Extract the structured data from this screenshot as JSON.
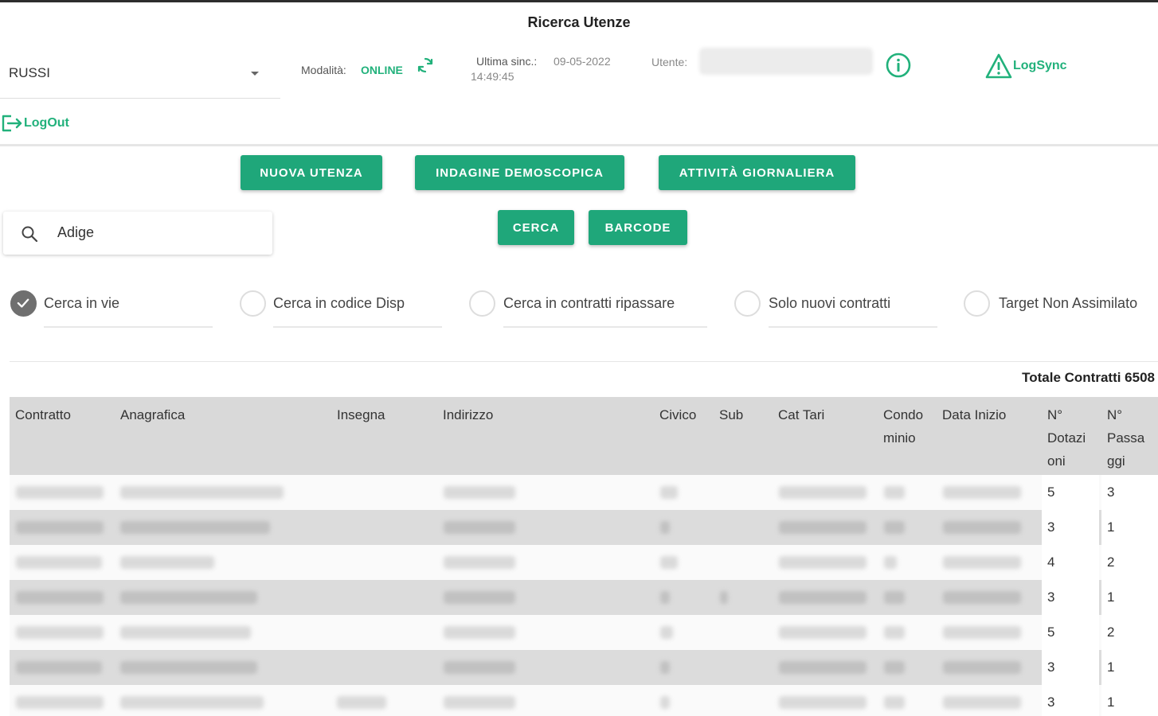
{
  "header": {
    "title": "Ricerca Utenze",
    "selector_value": "RUSSI",
    "mode_label": "Modalità:",
    "mode_value": "ONLINE",
    "sync_label": "Ultima sinc.:",
    "sync_date": "09-05-2022",
    "sync_time": "14:49:45",
    "user_label": "Utente:",
    "logsync_label": "LogSync",
    "logout_label": "LogOut"
  },
  "actions": {
    "new_user": "NUOVA UTENZA",
    "survey": "INDAGINE DEMOSCOPICA",
    "daily": "ATTIVITÀ GIORNALIERA",
    "search": "CERCA",
    "barcode": "BARCODE"
  },
  "search": {
    "value": "Adige"
  },
  "filters": [
    {
      "label": "Cerca in vie",
      "checked": true
    },
    {
      "label": "Cerca in codice Disp",
      "checked": false
    },
    {
      "label": "Cerca in contratti ripassare",
      "checked": false
    },
    {
      "label": "Solo nuovi contratti",
      "checked": false
    },
    {
      "label": "Target Non Assimilato",
      "checked": false
    }
  ],
  "table": {
    "total_label": "Totale Contratti 6508",
    "columns": [
      [
        "Contratto"
      ],
      [
        "Anagrafica"
      ],
      [
        "Insegna"
      ],
      [
        "Indirizzo"
      ],
      [
        "Civico"
      ],
      [
        "Sub"
      ],
      [
        "Cat Tari"
      ],
      [
        "Condo",
        "minio"
      ],
      [
        "Data Inizio"
      ],
      [
        "N°",
        "Dotazi",
        "oni"
      ],
      [
        "N°",
        "Passa",
        "ggi"
      ]
    ],
    "rows": [
      {
        "dotazioni": "5",
        "passaggi": "3"
      },
      {
        "dotazioni": "3",
        "passaggi": "1"
      },
      {
        "dotazioni": "4",
        "passaggi": "2"
      },
      {
        "dotazioni": "3",
        "passaggi": "1"
      },
      {
        "dotazioni": "5",
        "passaggi": "2"
      },
      {
        "dotazioni": "3",
        "passaggi": "1"
      },
      {
        "dotazioni": "3",
        "passaggi": "1"
      }
    ]
  },
  "colors": {
    "accent": "#1fa77a",
    "online": "#21b17b",
    "header_bg": "#d9d9d9"
  },
  "icons": [
    "dropdown-caret-icon",
    "sync-icon",
    "info-icon",
    "warning-icon",
    "logout-icon",
    "search-icon",
    "check-icon"
  ]
}
